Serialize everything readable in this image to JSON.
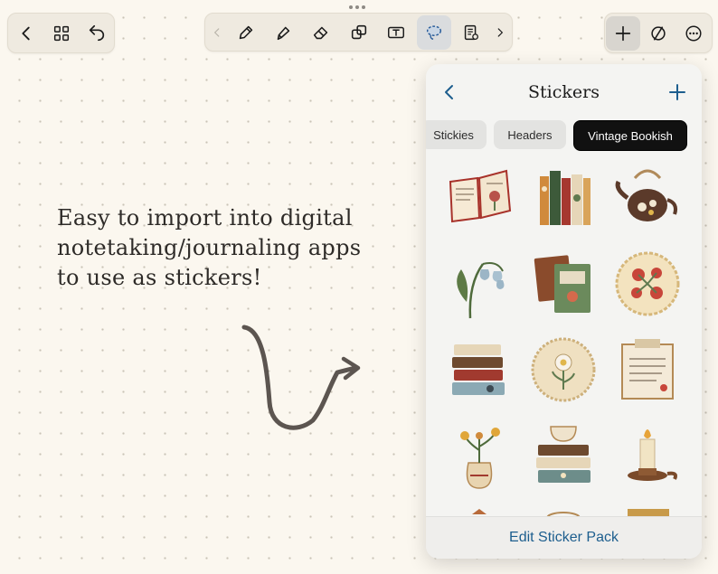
{
  "toolbar_left": {
    "icons": [
      "chevron-left-icon",
      "grid-icon",
      "undo-icon"
    ]
  },
  "toolbar_center": {
    "icons": [
      "chevron-left-icon",
      "pen-icon",
      "highlighter-icon",
      "eraser-icon",
      "shapes-icon",
      "text-box-icon",
      "lasso-icon",
      "document-icon",
      "chevron-right-icon"
    ],
    "selected_tool": "lasso-icon"
  },
  "toolbar_right": {
    "icons": [
      "plus-icon",
      "no-fill-icon",
      "more-icon"
    ],
    "active_tool": "plus-icon"
  },
  "canvas": {
    "note_lines": [
      "Easy to import into digital",
      "notetaking/journaling apps",
      "to use as stickers!"
    ]
  },
  "stickers_panel": {
    "title": "Stickers",
    "tabs": [
      "Stickies",
      "Headers",
      "Vintage Bookish"
    ],
    "active_tab": "Vintage Bookish",
    "stickers": [
      "open-book-sticker",
      "book-row-sticker",
      "teapot-sticker",
      "bluebell-sticker",
      "green-books-sticker",
      "floral-doily-sticker",
      "book-stack-sticker",
      "lace-doily-sticker",
      "note-card-sticker",
      "flower-vase-sticker",
      "teacup-books-sticker",
      "candle-sticker"
    ],
    "footer_label": "Edit Sticker Pack"
  },
  "colors": {
    "canvas_bg": "#fbf7ef",
    "toolbar_bg": "#efeae0",
    "panel_bg": "#f4f4f2",
    "accent": "#1d5e8e",
    "active_tab_bg": "#111111"
  }
}
